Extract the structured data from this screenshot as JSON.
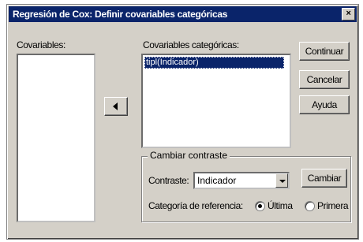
{
  "window": {
    "title": "Regresión de Cox: Definir covariables categóricas"
  },
  "covariables": {
    "label": "Covariables:",
    "items": []
  },
  "categorical": {
    "label": "Covariables categóricas:",
    "items": [
      "tipl(Indicador)"
    ]
  },
  "buttons": {
    "continue": "Continuar",
    "cancel": "Cancelar",
    "help": "Ayuda",
    "change": "Cambiar"
  },
  "contrast": {
    "group_label": "Cambiar contraste",
    "contrast_label": "Contraste:",
    "contrast_value": "Indicador",
    "reference_label": "Categoría de referencia:",
    "last_label": "Última",
    "first_label": "Primera",
    "selected": "last"
  }
}
